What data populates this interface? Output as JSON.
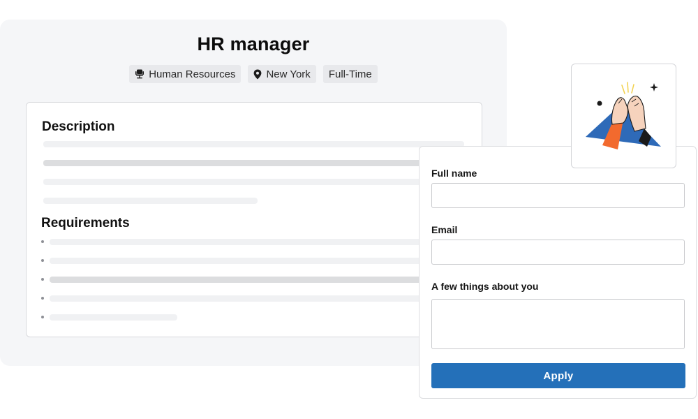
{
  "job": {
    "title": "HR manager",
    "tags": [
      {
        "label": "Human Resources",
        "icon": "office-chair-icon"
      },
      {
        "label": "New York",
        "icon": "location-pin-icon"
      },
      {
        "label": "Full-Time",
        "icon": ""
      }
    ],
    "description_heading": "Description",
    "requirements_heading": "Requirements"
  },
  "form": {
    "full_name_label": "Full name",
    "full_name_value": "",
    "email_label": "Email",
    "email_value": "",
    "about_label": "A few things about you",
    "about_value": "",
    "apply_label": "Apply"
  },
  "illustration": {
    "icon": "high-five-illustration"
  },
  "colors": {
    "accent": "#2470b9",
    "panel_bg": "#f5f6f8",
    "illustration_orange": "#f26a2e",
    "illustration_blue": "#2e6ab8",
    "skin": "#f6d3bd"
  }
}
